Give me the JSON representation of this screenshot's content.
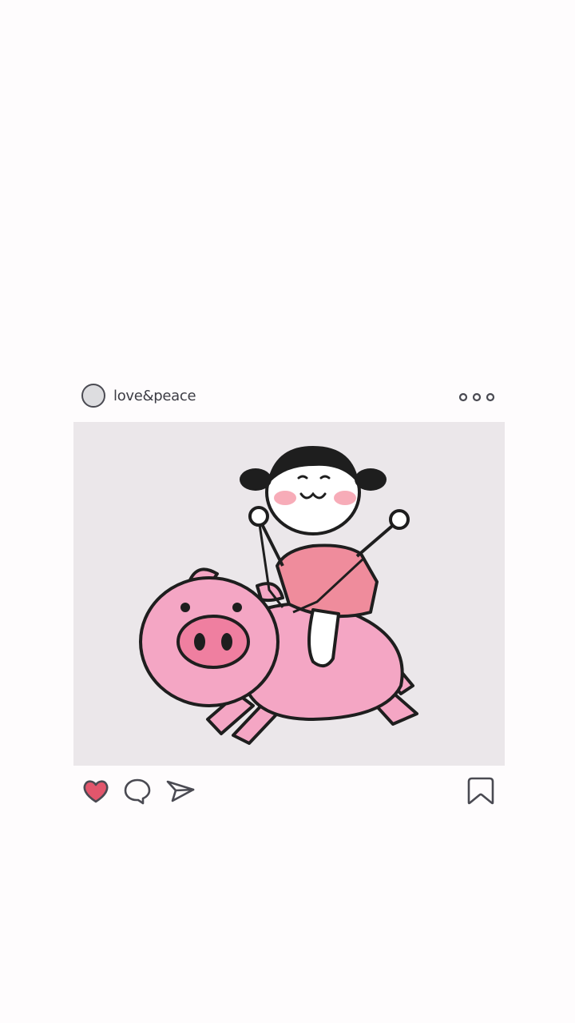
{
  "post": {
    "username": "love&peace",
    "liked": true
  },
  "icons": {
    "avatar": "avatar-circle",
    "more": "more-dots-icon",
    "like": "heart-icon",
    "comment": "comment-icon",
    "share": "send-icon",
    "save": "bookmark-icon"
  },
  "colors": {
    "like_active": "#e2566c",
    "outline": "#4a4a52",
    "pig_pink": "#f4a6c4",
    "shirt": "#ef8c9c",
    "photo_bg": "#ebe7ea"
  }
}
